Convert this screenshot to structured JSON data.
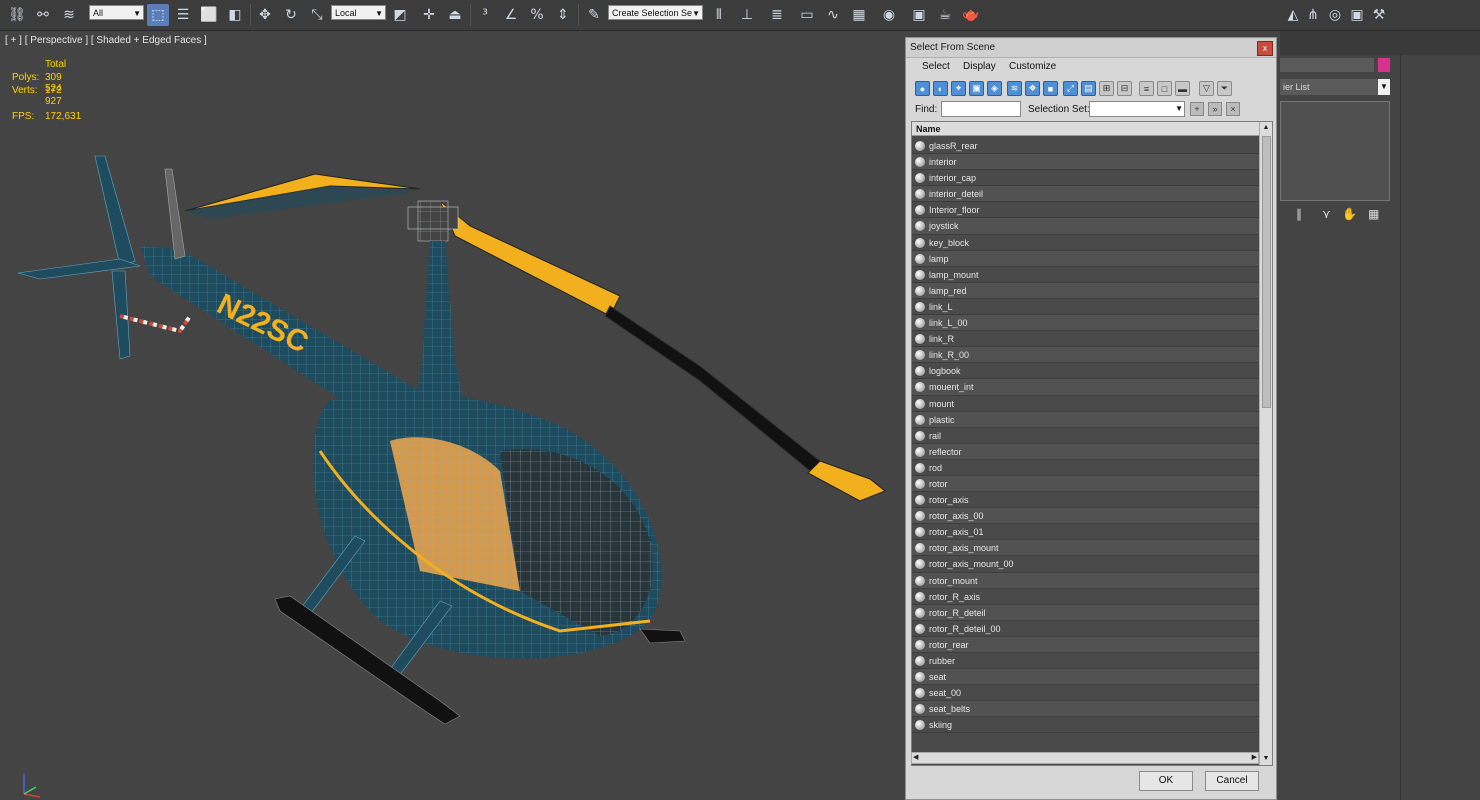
{
  "toolbar": {
    "selection_filter": "All",
    "reference_coord": "Local",
    "named_selection_placeholder": "Create Selection Se",
    "icons": [
      "link-icon",
      "unlink-icon",
      "bind-space-warp-icon",
      "select-object-icon",
      "select-by-name-icon",
      "rect-selection-icon",
      "window-crossing-icon",
      "move-icon",
      "rotate-icon",
      "scale-icon",
      "pivot-icon",
      "select-manipulate-icon",
      "snap-3d-icon",
      "angle-snap-icon",
      "percent-snap-icon",
      "spinner-snap-icon",
      "edit-named-sel-icon",
      "mirror-icon",
      "align-icon",
      "layer-manager-icon",
      "toggle-ribbon-icon",
      "curve-editor-icon",
      "schematic-view-icon",
      "material-editor-icon",
      "render-setup-icon",
      "rendered-frame-icon",
      "render-icon"
    ]
  },
  "viewport": {
    "label": "[ + ] [ Perspective ] [ Shaded + Edged Faces ]",
    "stats": {
      "header": "Total",
      "polys_label": "Polys:",
      "polys_value": "309 524",
      "verts_label": "Verts:",
      "verts_value": "172 927",
      "fps_label": "FPS:",
      "fps_value": "172,631"
    },
    "registration": "N22SC"
  },
  "command_panel": {
    "modifier_list": "ier List"
  },
  "dialog": {
    "title": "Select From Scene",
    "close": "x",
    "menu": [
      "Select",
      "Display",
      "Customize"
    ],
    "find_label": "Find:",
    "selection_set_label": "Selection Set:",
    "column_name": "Name",
    "items": [
      "glassR_rear",
      "interior",
      "interior_cap",
      "interior_deteil",
      "Interior_floor",
      "joystick",
      "key_block",
      "lamp",
      "lamp_mount",
      "lamp_red",
      "link_L",
      "link_L_00",
      "link_R",
      "link_R_00",
      "logbook",
      "mouent_int",
      "mount",
      "plastic",
      "rail",
      "reflector",
      "rod",
      "rotor",
      "rotor_axis",
      "rotor_axis_00",
      "rotor_axis_01",
      "rotor_axis_mount",
      "rotor_axis_mount_00",
      "rotor_mount",
      "rotor_R_axis",
      "rotor_R_deteil",
      "rotor_R_deteil_00",
      "rotor_rear",
      "rubber",
      "seat",
      "seat_00",
      "seat_belts",
      "skiing"
    ],
    "ok": "OK",
    "cancel": "Cancel"
  },
  "colors": {
    "viewport_bg": "#444444",
    "heli_body": "#1e4b5e",
    "wire": "#5fa8c8",
    "stripe": "#f2b01e",
    "stats_text": "#ffd200",
    "color_swatch": "#d8318c"
  }
}
